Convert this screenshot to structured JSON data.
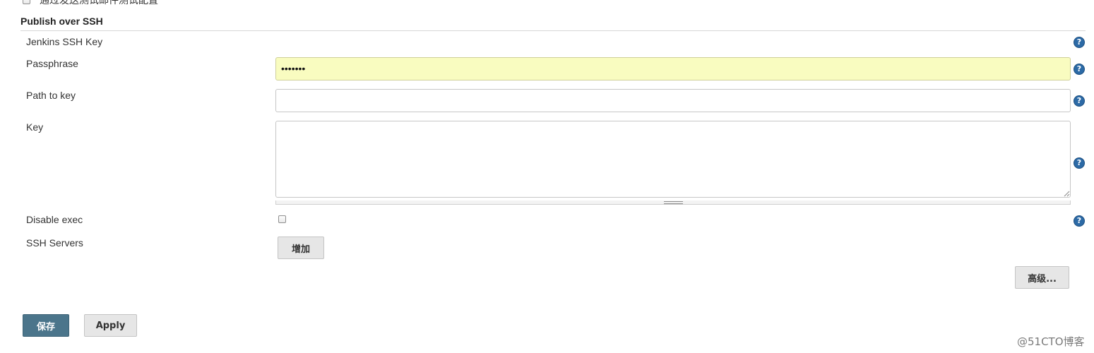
{
  "top_option": {
    "label": "通过发送测试邮件测试配置",
    "checked": false
  },
  "section": {
    "title": "Publish over SSH"
  },
  "fields": {
    "jenkins_ssh_key_label": "Jenkins SSH Key",
    "passphrase_label": "Passphrase",
    "passphrase_value": "•••••••",
    "path_to_key_label": "Path to key",
    "path_to_key_value": "",
    "key_label": "Key",
    "key_value": "",
    "disable_exec_label": "Disable exec",
    "disable_exec_checked": false,
    "ssh_servers_label": "SSH Servers"
  },
  "buttons": {
    "add": "增加",
    "advanced": "高级...",
    "save": "保存",
    "apply": "Apply"
  },
  "help_icon_glyph": "?",
  "watermark": "@51CTO博客",
  "colors": {
    "passphrase_bg": "#f9fcc0",
    "save_button_bg": "#4b758b",
    "help_icon_bg": "#2c6aa6"
  }
}
